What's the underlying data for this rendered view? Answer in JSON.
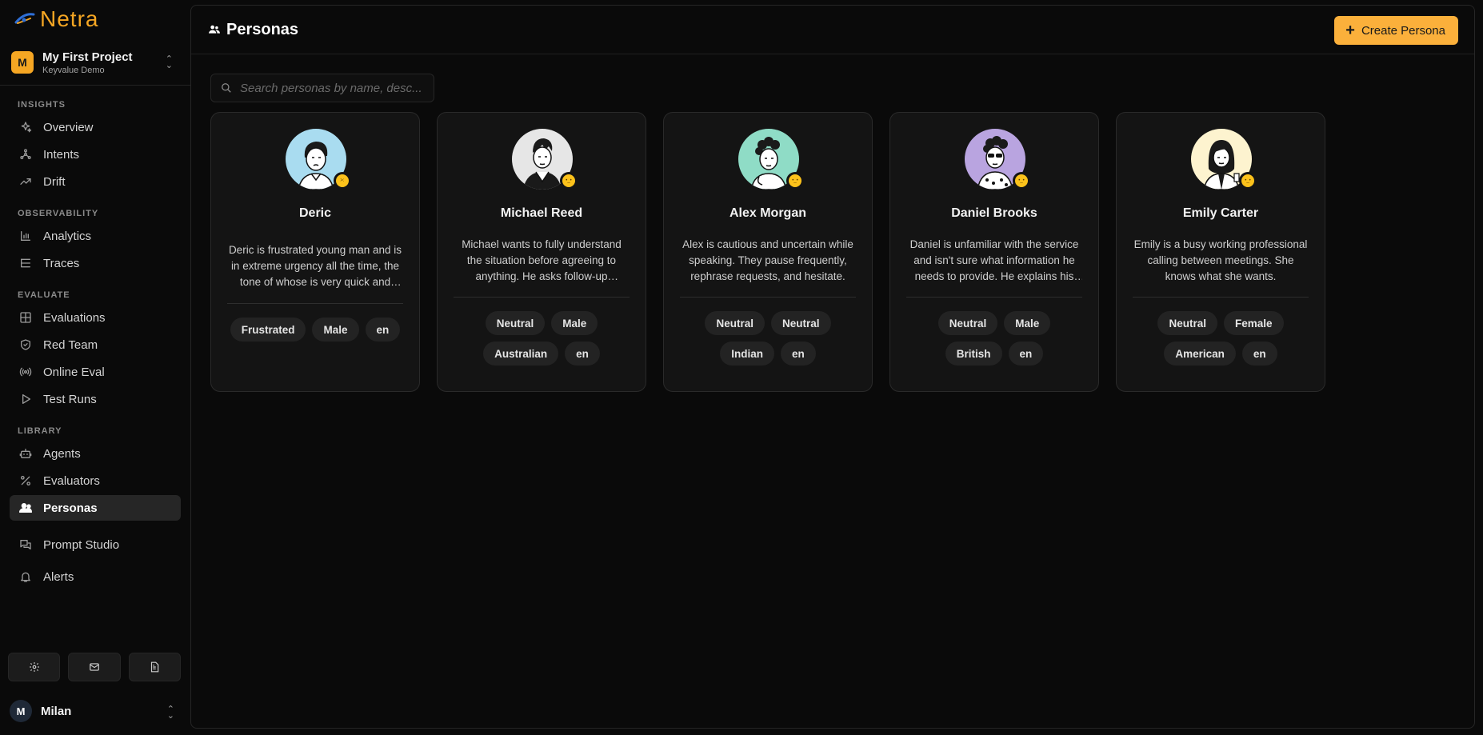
{
  "app": {
    "name": "Netra"
  },
  "project": {
    "initial": "M",
    "name": "My First Project",
    "subtitle": "Keyvalue Demo"
  },
  "sidebar": {
    "sections": [
      {
        "label": "INSIGHTS",
        "items": [
          {
            "label": "Overview",
            "icon": "sparkles-icon"
          },
          {
            "label": "Intents",
            "icon": "nodes-icon"
          },
          {
            "label": "Drift",
            "icon": "trend-icon"
          }
        ]
      },
      {
        "label": "OBSERVABILITY",
        "items": [
          {
            "label": "Analytics",
            "icon": "bar-chart-icon"
          },
          {
            "label": "Traces",
            "icon": "list-tree-icon"
          }
        ]
      },
      {
        "label": "EVALUATE",
        "items": [
          {
            "label": "Evaluations",
            "icon": "grid-icon"
          },
          {
            "label": "Red Team",
            "icon": "shield-icon"
          },
          {
            "label": "Online Eval",
            "icon": "radio-icon"
          },
          {
            "label": "Test Runs",
            "icon": "play-icon"
          }
        ]
      },
      {
        "label": "LIBRARY",
        "items": [
          {
            "label": "Agents",
            "icon": "bot-icon"
          },
          {
            "label": "Evaluators",
            "icon": "percent-icon"
          },
          {
            "label": "Personas",
            "icon": "users-icon",
            "active": true
          }
        ]
      }
    ],
    "extra_items": [
      {
        "label": "Prompt Studio",
        "icon": "messages-icon"
      },
      {
        "label": "Alerts",
        "icon": "bell-icon"
      }
    ],
    "bottom_buttons": [
      "settings-icon",
      "mail-icon",
      "document-icon"
    ],
    "user": {
      "initial": "M",
      "name": "Milan"
    }
  },
  "page": {
    "title": "Personas",
    "create_label": "Create Persona",
    "search_placeholder": "Search personas by name, desc..."
  },
  "personas": [
    {
      "name": "Deric",
      "description": "Deric is frustrated young man and is in extreme urgency all the time, the tone of whose is very quick and impatient.",
      "tags": [
        "Frustrated",
        "Male",
        "en"
      ],
      "avatar_bg": "#a9dcf0",
      "mood": "frustrated"
    },
    {
      "name": "Michael Reed",
      "description": "Michael wants to fully understand the situation before agreeing to anything. He asks follow-up questions.",
      "tags": [
        "Neutral",
        "Male",
        "Australian",
        "en"
      ],
      "avatar_bg": "#e6e6e6",
      "mood": "neutral"
    },
    {
      "name": "Alex Morgan",
      "description": "Alex is cautious and uncertain while speaking. They pause frequently, rephrase requests, and hesitate.",
      "tags": [
        "Neutral",
        "Neutral",
        "Indian",
        "en"
      ],
      "avatar_bg": "#8fdcc6",
      "mood": "neutral"
    },
    {
      "name": "Daniel Brooks",
      "description": "Daniel is unfamiliar with the service and isn't sure what information he needs to provide. He explains his situation.",
      "tags": [
        "Neutral",
        "Male",
        "British",
        "en"
      ],
      "avatar_bg": "#b9a4e0",
      "mood": "neutral"
    },
    {
      "name": "Emily Carter",
      "description": "Emily is a busy working professional calling between meetings. She knows what she wants.",
      "tags": [
        "Neutral",
        "Female",
        "American",
        "en"
      ],
      "avatar_bg": "#fdf3cf",
      "mood": "neutral"
    }
  ]
}
